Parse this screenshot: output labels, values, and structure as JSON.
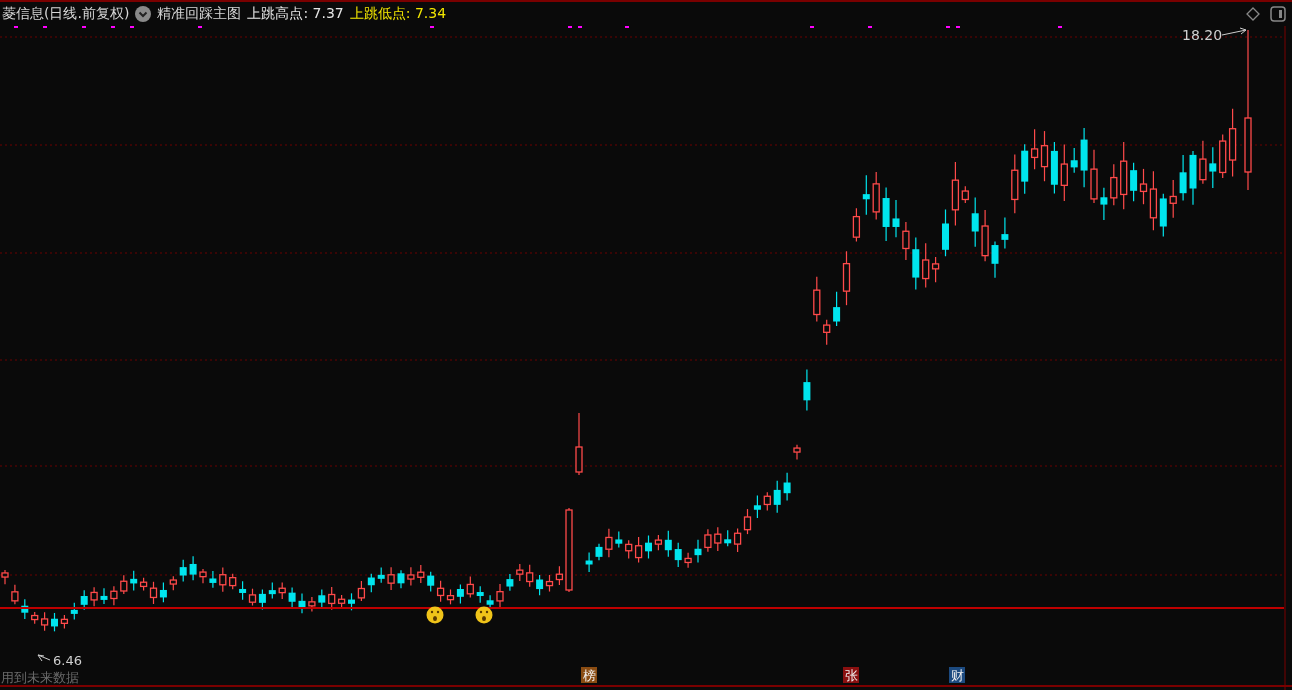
{
  "header": {
    "title": "菱信息(日线.前复权)",
    "indicator": "精准回踩主图",
    "legend": [
      {
        "text": "上跳高点: 7.37",
        "color": "#e6e6e6"
      },
      {
        "text": "上跳低点: 7.34",
        "color": "#f2e600"
      }
    ]
  },
  "chart": {
    "max_label": "18.20",
    "min_label": "6.46",
    "note": "用到未来数据",
    "markers": [
      {
        "text": "榜",
        "color": "#8a4c12"
      },
      {
        "text": "张",
        "color": "#8a1010"
      },
      {
        "text": "财",
        "color": "#1c4a80"
      }
    ]
  }
}
